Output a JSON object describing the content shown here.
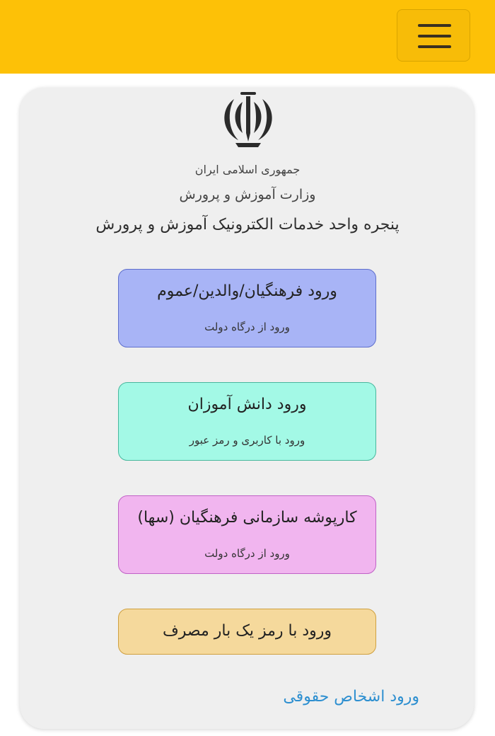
{
  "header": {
    "menu_icon": "hamburger-menu-icon",
    "bar_color": "#fdc107"
  },
  "card": {
    "emblem_icon": "iran-emblem-icon",
    "country": "جمهوری اسلامی ایران",
    "ministry": "وزارت آموزش و پرورش",
    "portal_title": "پنجره واحد خدمات الکترونیک آموزش و پرورش"
  },
  "logins": [
    {
      "title": "ورود فرهنگیان/والدین/عموم",
      "subtitle": "ورود از درگاه دولت",
      "color": "#a8b4f6"
    },
    {
      "title": "ورود دانش آموزان",
      "subtitle": "ورود با کاربری و رمز عبور",
      "color": "#a3f9e6"
    },
    {
      "title": "کارپوشه سازمانی فرهنگیان (سها)",
      "subtitle": "ورود از درگاه دولت",
      "color": "#f1b5ef"
    },
    {
      "title": "ورود با رمز یک بار مصرف",
      "color": "#f5d99c"
    }
  ],
  "legal_entities_link": "ورود اشخاص حقوقی"
}
